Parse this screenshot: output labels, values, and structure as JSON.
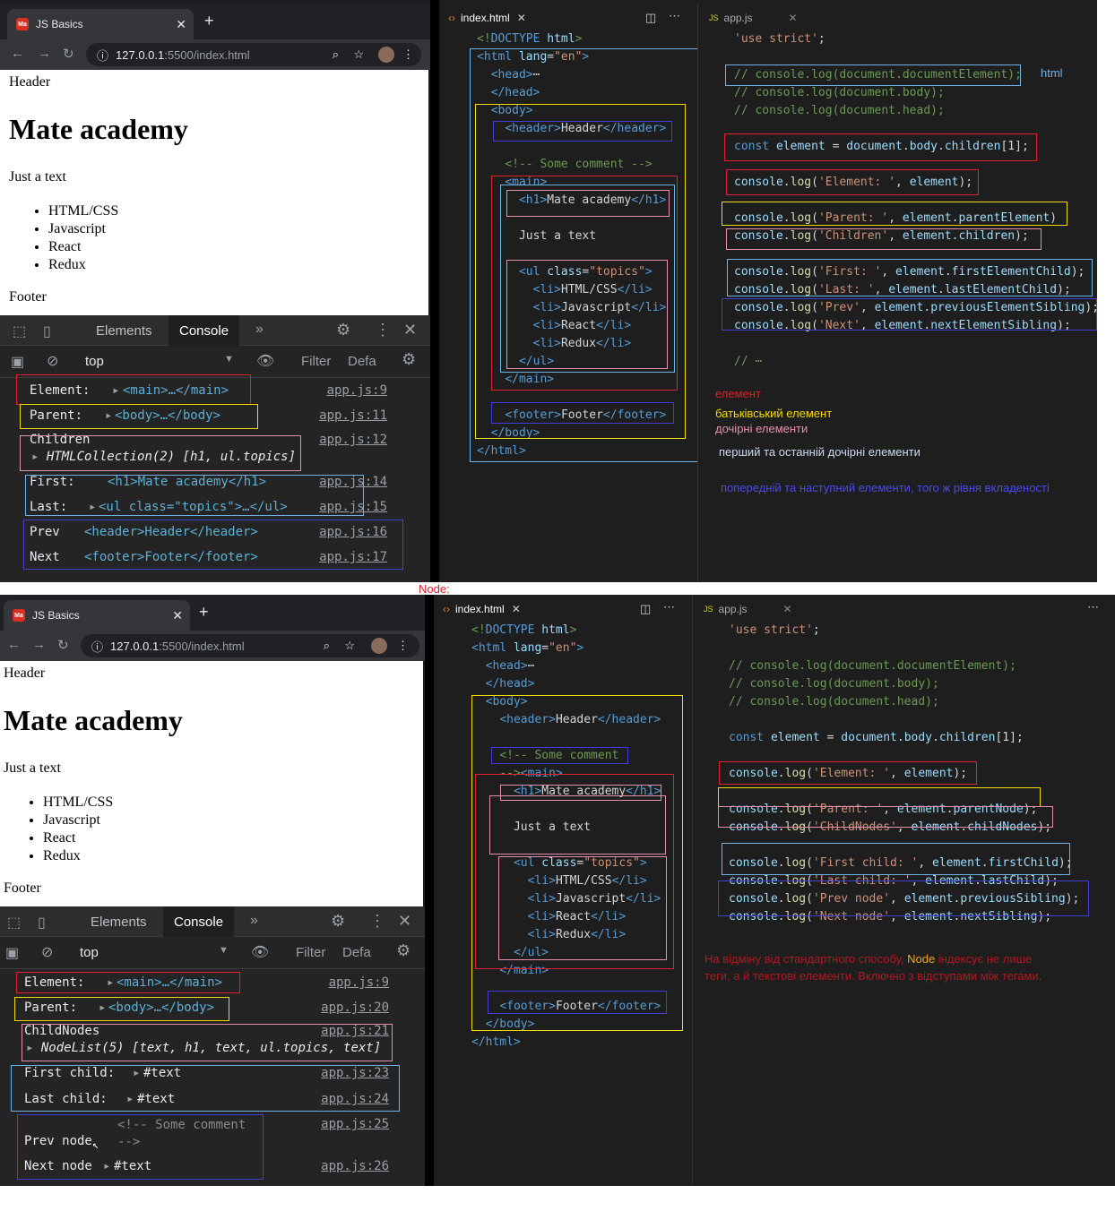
{
  "top": {
    "browser": {
      "tab_title": "JS Basics",
      "favicon_text": "Ma",
      "url_host": "127.0.0.1",
      "url_rest": ":5500/index.html"
    },
    "page": {
      "header": "Header",
      "h1": "Mate academy",
      "text": "Just a text",
      "items": [
        "HTML/CSS",
        "Javascript",
        "React",
        "Redux"
      ],
      "footer": "Footer"
    },
    "devtools": {
      "tabs": [
        "Elements",
        "Console"
      ],
      "more": "»",
      "context": "top",
      "filter": "Filter",
      "levels": "Defa",
      "lines": [
        {
          "label": "Element:",
          "value": "<main>…</main>",
          "link": "app.js:9"
        },
        {
          "label": "Parent:",
          "value": "<body>…</body>",
          "link": "app.js:11"
        },
        {
          "label": "Children",
          "value": "HTMLCollection(2) [h1, ul.topics]",
          "link": "app.js:12"
        },
        {
          "label": "First:",
          "value": "<h1>Mate academy</h1>",
          "link": "app.js:14"
        },
        {
          "label": "Last:",
          "value": "<ul class=\"topics\">…</ul>",
          "link": "app.js:15"
        },
        {
          "label": "Prev",
          "value": "<header>Header</header>",
          "link": "app.js:16"
        },
        {
          "label": "Next",
          "value": "<footer>Footer</footer>",
          "link": "app.js:17"
        }
      ]
    },
    "editor": {
      "tab1": "index.html",
      "tab2": "app.js",
      "tab2_prefix": "JS"
    },
    "notes": {
      "html": "html",
      "element": "елемент",
      "parent": "батьківський елемент",
      "children": "дочірні елементи",
      "first_last": "перший та останній дочірні елементи",
      "prev_next": "попередній та наступний елементи, того ж рівня вкладеності"
    }
  },
  "divider_label": "Node:",
  "bottom": {
    "devtools": {
      "lines": [
        {
          "label": "Element:",
          "value": "<main>…</main>",
          "link": "app.js:9"
        },
        {
          "label": "Parent:",
          "value": "<body>…</body>",
          "link": "app.js:20"
        },
        {
          "label": "ChildNodes",
          "value": "NodeList(5) [text, h1, text, ul.topics, text]",
          "link": "app.js:21"
        },
        {
          "label": "First child:",
          "value": "#text",
          "link": "app.js:23"
        },
        {
          "label": "Last child:",
          "value": "#text",
          "link": "app.js:24"
        },
        {
          "label": "Prev node",
          "value": "<!-- Some comment -->",
          "link": "app.js:25"
        },
        {
          "label": "Next node",
          "value": "#text",
          "link": "app.js:26"
        }
      ]
    },
    "note_prefix": "На відміну від стандартного способу, ",
    "note_node": "Node",
    "note_suffix": " індексує не лише теги, а й текстові елементи. Включно з відступами між тегами."
  },
  "colors": {
    "red": "#e0202a",
    "yellow": "#f5d90a",
    "pink": "#e890b0",
    "lightblue": "#6fb3e8",
    "blue": "#3f3fd8"
  }
}
